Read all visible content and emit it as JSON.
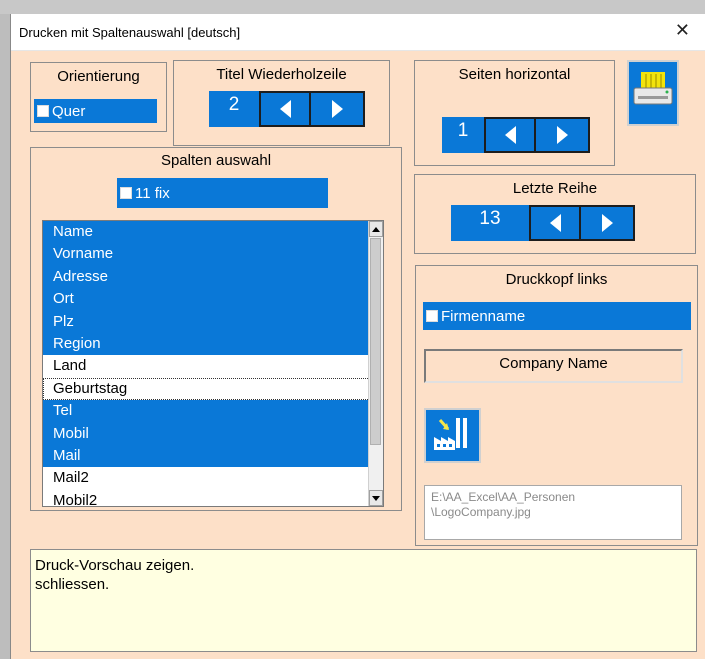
{
  "window": {
    "title": "Drucken mit Spaltenauswahl  [deutsch]",
    "close_label": "✕"
  },
  "orientierung": {
    "title": "Orientierung",
    "checkbox_label": "Quer",
    "checked": false
  },
  "titel_wiederholzeile": {
    "title": "Titel Wiederholzeile",
    "value": "2"
  },
  "seiten_horizontal": {
    "title": "Seiten horizontal",
    "value": "1"
  },
  "print_button": {
    "icon": "printer-icon"
  },
  "spalten_auswahl": {
    "title": "Spalten auswahl",
    "fix_label": "11 fix",
    "items": [
      {
        "label": "Name",
        "selected": true
      },
      {
        "label": "Vorname",
        "selected": true
      },
      {
        "label": "Adresse",
        "selected": true
      },
      {
        "label": "Ort",
        "selected": true
      },
      {
        "label": "Plz",
        "selected": true
      },
      {
        "label": "Region",
        "selected": true
      },
      {
        "label": "Land",
        "selected": false
      },
      {
        "label": "Geburtstag",
        "selected": false
      },
      {
        "label": "Tel",
        "selected": true
      },
      {
        "label": "Mobil",
        "selected": true
      },
      {
        "label": "Mail",
        "selected": true
      },
      {
        "label": "Mail2",
        "selected": false
      },
      {
        "label": "Mobil2",
        "selected": false
      }
    ]
  },
  "letzte_reihe": {
    "title": "Letzte Reihe",
    "value": "13"
  },
  "druckkopf_links": {
    "title": "Druckkopf links",
    "checkbox_label": "Firmenname",
    "checked": false,
    "company_name": "Company Name",
    "logo_icon": "factory-icon",
    "logo_path": "E:\\AA_Excel\\AA_Personen\n\\LogoCompany.jpg"
  },
  "footer": {
    "line1": "Druck-Vorschau zeigen.",
    "line2": "schliessen."
  },
  "colors": {
    "accent": "#0a78d7",
    "dialog_bg": "#fde0c8",
    "footer_bg": "#ffffe1"
  }
}
